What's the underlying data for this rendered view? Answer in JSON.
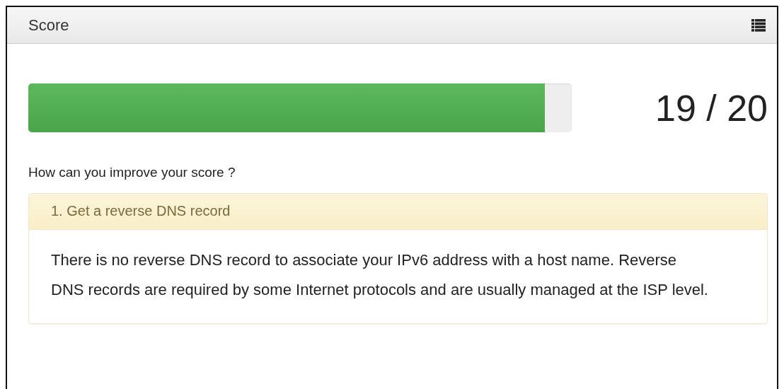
{
  "panel": {
    "title": "Score"
  },
  "score": {
    "level": 0.95,
    "reading": "19 / 20"
  },
  "question": "How can you improve your score ?",
  "tips": [
    {
      "title": "1. Get a reverse DNS record",
      "body": "There is no reverse DNS record to associate your IPv6 address with a host name. Reverse DNS records are required by some Internet protocols and are usually managed at the ISP level."
    }
  ]
}
